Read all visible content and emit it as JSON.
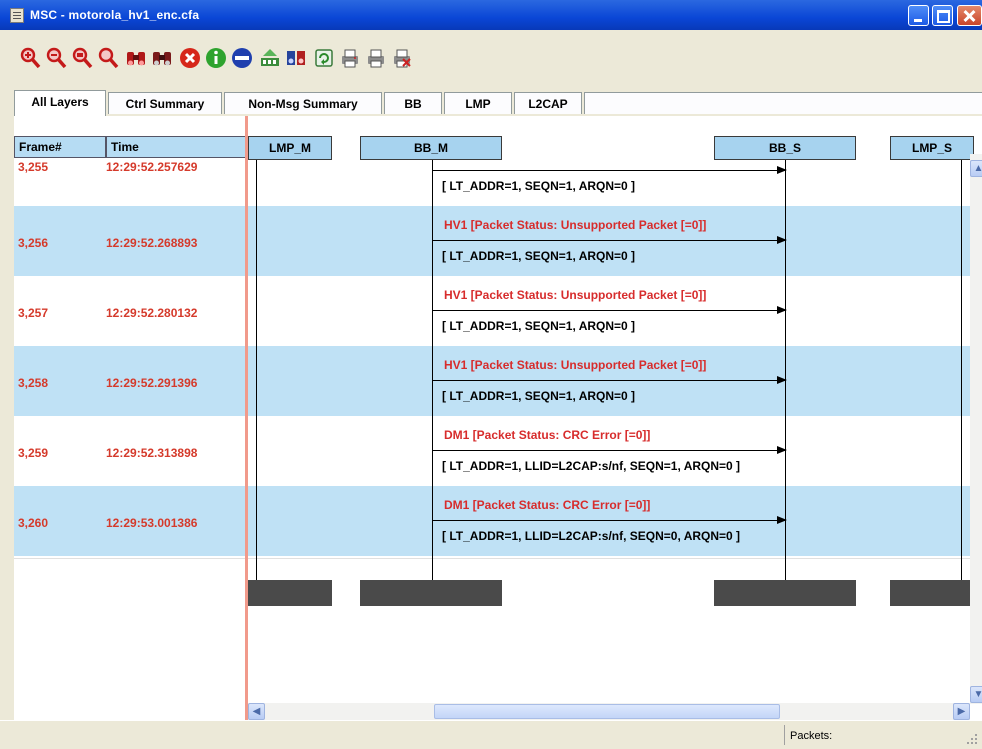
{
  "window": {
    "title": "MSC - motorola_hv1_enc.cfa"
  },
  "toolbar": {
    "icons": [
      "zoom-in-red-icon",
      "zoom-out-red-icon",
      "zoom-red-icon",
      "zoom-search-red-icon",
      "binoculars-find-icon",
      "binoculars-find-next-icon",
      "error-icon",
      "info-icon",
      "stop-icon",
      "export-icon",
      "find-book-icon",
      "refresh-icon",
      "print-icon",
      "print-preview-icon",
      "print-setup-icon"
    ]
  },
  "tabs": [
    {
      "label": "All Layers",
      "active": true
    },
    {
      "label": "Ctrl Summary",
      "active": false
    },
    {
      "label": "Non-Msg Summary",
      "active": false
    },
    {
      "label": "BB",
      "active": false
    },
    {
      "label": "LMP",
      "active": false
    },
    {
      "label": "L2CAP",
      "active": false
    }
  ],
  "columns": {
    "frame": "Frame#",
    "time": "Time"
  },
  "lifelines": [
    "LMP_M",
    "BB_M",
    "BB_S",
    "LMP_S"
  ],
  "rows": [
    {
      "frame": "3,255",
      "time": "12:29:52.257629",
      "line1": "",
      "line2": "[ LT_ADDR=1, SEQN=1, ARQN=0 ]"
    },
    {
      "frame": "3,256",
      "time": "12:29:52.268893",
      "line1": "HV1 [Packet Status: Unsupported Packet [=0]]",
      "line2": "[ LT_ADDR=1, SEQN=1, ARQN=0 ]"
    },
    {
      "frame": "3,257",
      "time": "12:29:52.280132",
      "line1": "HV1 [Packet Status: Unsupported Packet [=0]]",
      "line2": "[ LT_ADDR=1, SEQN=1, ARQN=0 ]"
    },
    {
      "frame": "3,258",
      "time": "12:29:52.291396",
      "line1": "HV1 [Packet Status: Unsupported Packet [=0]]",
      "line2": "[ LT_ADDR=1, SEQN=1, ARQN=0 ]"
    },
    {
      "frame": "3,259",
      "time": "12:29:52.313898",
      "line1": "DM1 [Packet Status: CRC Error [=0]]",
      "line2": "[ LT_ADDR=1, LLID=L2CAP:s/nf, SEQN=1, ARQN=0 ]"
    },
    {
      "frame": "3,260",
      "time": "12:29:53.001386",
      "line1": "DM1 [Packet Status: CRC Error [=0]]",
      "line2": "[ LT_ADDR=1, LLID=L2CAP:s/nf, SEQN=0, ARQN=0 ]"
    }
  ],
  "status": {
    "packets_label": "Packets:"
  },
  "colors": {
    "band": "#bfe1f5",
    "header": "#b6dcf3",
    "frame_text": "#d53a2b",
    "msg_red": "#d72c2c",
    "divider": "#f19a8b"
  }
}
